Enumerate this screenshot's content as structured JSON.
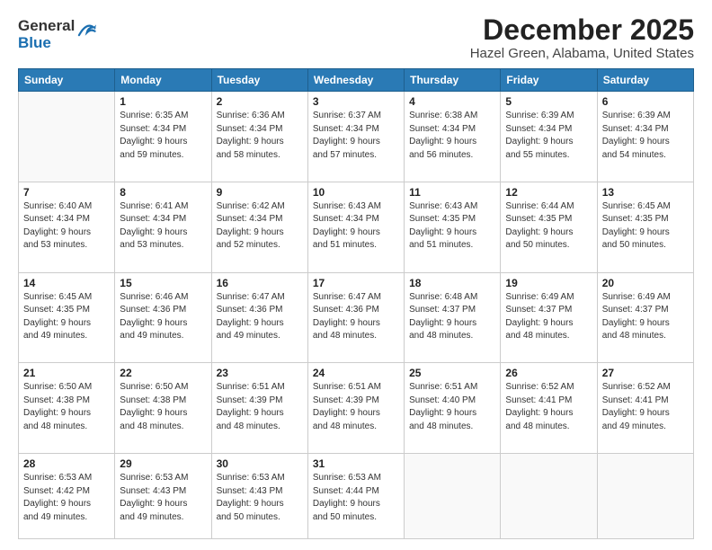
{
  "logo": {
    "general": "General",
    "blue": "Blue"
  },
  "title": "December 2025",
  "subtitle": "Hazel Green, Alabama, United States",
  "weekdays": [
    "Sunday",
    "Monday",
    "Tuesday",
    "Wednesday",
    "Thursday",
    "Friday",
    "Saturday"
  ],
  "rows": [
    [
      {
        "day": "",
        "info": ""
      },
      {
        "day": "1",
        "info": "Sunrise: 6:35 AM\nSunset: 4:34 PM\nDaylight: 9 hours\nand 59 minutes."
      },
      {
        "day": "2",
        "info": "Sunrise: 6:36 AM\nSunset: 4:34 PM\nDaylight: 9 hours\nand 58 minutes."
      },
      {
        "day": "3",
        "info": "Sunrise: 6:37 AM\nSunset: 4:34 PM\nDaylight: 9 hours\nand 57 minutes."
      },
      {
        "day": "4",
        "info": "Sunrise: 6:38 AM\nSunset: 4:34 PM\nDaylight: 9 hours\nand 56 minutes."
      },
      {
        "day": "5",
        "info": "Sunrise: 6:39 AM\nSunset: 4:34 PM\nDaylight: 9 hours\nand 55 minutes."
      },
      {
        "day": "6",
        "info": "Sunrise: 6:39 AM\nSunset: 4:34 PM\nDaylight: 9 hours\nand 54 minutes."
      }
    ],
    [
      {
        "day": "7",
        "info": "Sunrise: 6:40 AM\nSunset: 4:34 PM\nDaylight: 9 hours\nand 53 minutes."
      },
      {
        "day": "8",
        "info": "Sunrise: 6:41 AM\nSunset: 4:34 PM\nDaylight: 9 hours\nand 53 minutes."
      },
      {
        "day": "9",
        "info": "Sunrise: 6:42 AM\nSunset: 4:34 PM\nDaylight: 9 hours\nand 52 minutes."
      },
      {
        "day": "10",
        "info": "Sunrise: 6:43 AM\nSunset: 4:34 PM\nDaylight: 9 hours\nand 51 minutes."
      },
      {
        "day": "11",
        "info": "Sunrise: 6:43 AM\nSunset: 4:35 PM\nDaylight: 9 hours\nand 51 minutes."
      },
      {
        "day": "12",
        "info": "Sunrise: 6:44 AM\nSunset: 4:35 PM\nDaylight: 9 hours\nand 50 minutes."
      },
      {
        "day": "13",
        "info": "Sunrise: 6:45 AM\nSunset: 4:35 PM\nDaylight: 9 hours\nand 50 minutes."
      }
    ],
    [
      {
        "day": "14",
        "info": "Sunrise: 6:45 AM\nSunset: 4:35 PM\nDaylight: 9 hours\nand 49 minutes."
      },
      {
        "day": "15",
        "info": "Sunrise: 6:46 AM\nSunset: 4:36 PM\nDaylight: 9 hours\nand 49 minutes."
      },
      {
        "day": "16",
        "info": "Sunrise: 6:47 AM\nSunset: 4:36 PM\nDaylight: 9 hours\nand 49 minutes."
      },
      {
        "day": "17",
        "info": "Sunrise: 6:47 AM\nSunset: 4:36 PM\nDaylight: 9 hours\nand 48 minutes."
      },
      {
        "day": "18",
        "info": "Sunrise: 6:48 AM\nSunset: 4:37 PM\nDaylight: 9 hours\nand 48 minutes."
      },
      {
        "day": "19",
        "info": "Sunrise: 6:49 AM\nSunset: 4:37 PM\nDaylight: 9 hours\nand 48 minutes."
      },
      {
        "day": "20",
        "info": "Sunrise: 6:49 AM\nSunset: 4:37 PM\nDaylight: 9 hours\nand 48 minutes."
      }
    ],
    [
      {
        "day": "21",
        "info": "Sunrise: 6:50 AM\nSunset: 4:38 PM\nDaylight: 9 hours\nand 48 minutes."
      },
      {
        "day": "22",
        "info": "Sunrise: 6:50 AM\nSunset: 4:38 PM\nDaylight: 9 hours\nand 48 minutes."
      },
      {
        "day": "23",
        "info": "Sunrise: 6:51 AM\nSunset: 4:39 PM\nDaylight: 9 hours\nand 48 minutes."
      },
      {
        "day": "24",
        "info": "Sunrise: 6:51 AM\nSunset: 4:39 PM\nDaylight: 9 hours\nand 48 minutes."
      },
      {
        "day": "25",
        "info": "Sunrise: 6:51 AM\nSunset: 4:40 PM\nDaylight: 9 hours\nand 48 minutes."
      },
      {
        "day": "26",
        "info": "Sunrise: 6:52 AM\nSunset: 4:41 PM\nDaylight: 9 hours\nand 48 minutes."
      },
      {
        "day": "27",
        "info": "Sunrise: 6:52 AM\nSunset: 4:41 PM\nDaylight: 9 hours\nand 49 minutes."
      }
    ],
    [
      {
        "day": "28",
        "info": "Sunrise: 6:53 AM\nSunset: 4:42 PM\nDaylight: 9 hours\nand 49 minutes."
      },
      {
        "day": "29",
        "info": "Sunrise: 6:53 AM\nSunset: 4:43 PM\nDaylight: 9 hours\nand 49 minutes."
      },
      {
        "day": "30",
        "info": "Sunrise: 6:53 AM\nSunset: 4:43 PM\nDaylight: 9 hours\nand 50 minutes."
      },
      {
        "day": "31",
        "info": "Sunrise: 6:53 AM\nSunset: 4:44 PM\nDaylight: 9 hours\nand 50 minutes."
      },
      {
        "day": "",
        "info": ""
      },
      {
        "day": "",
        "info": ""
      },
      {
        "day": "",
        "info": ""
      }
    ]
  ]
}
